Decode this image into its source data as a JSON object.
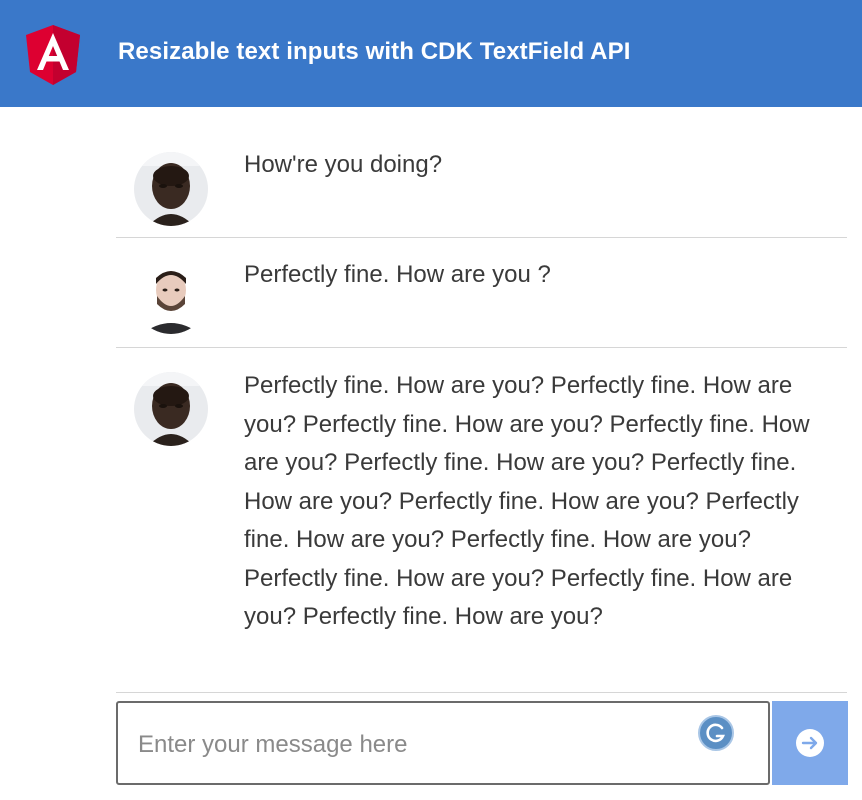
{
  "header": {
    "title": "Resizable text inputs with CDK TextField API",
    "logo_icon": "angular-logo-icon",
    "background": "#3a78c9"
  },
  "messages": [
    {
      "avatar": "avatar-dark-skin-man-icon",
      "text": "How're you doing?"
    },
    {
      "avatar": "avatar-bearded-man-icon",
      "text": "Perfectly fine. How are you ?"
    },
    {
      "avatar": "avatar-dark-skin-man-icon",
      "text": "Perfectly fine. How are you? Perfectly fine. How are you? Perfectly fine. How are you? Perfectly fine. How are you? Perfectly fine. How are you? Perfectly fine. How are you? Perfectly fine. How are you? Perfectly fine. How are you? Perfectly fine. How are you? Perfectly fine. How are you? Perfectly fine. How are you? Perfectly fine. How are you?"
    }
  ],
  "composer": {
    "placeholder": "Enter your message here",
    "value": "",
    "grammarly_icon": "grammarly-icon",
    "send_icon": "arrow-right-circle-icon",
    "send_background": "#7fa9ea"
  }
}
